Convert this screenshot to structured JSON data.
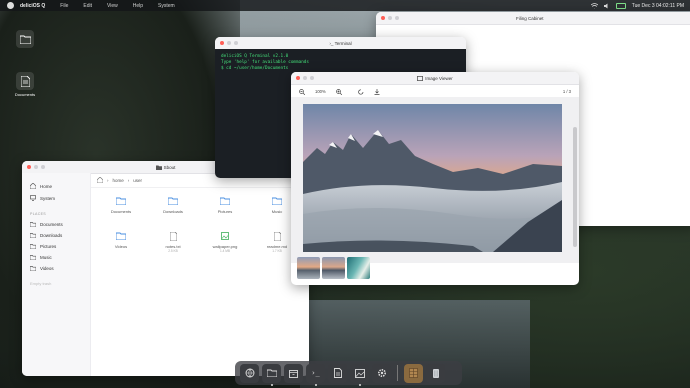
{
  "menubar": {
    "brand": "deliciOS Q",
    "menus": [
      "File",
      "Edit",
      "View",
      "Help",
      "System"
    ],
    "clock": "Tue Dec 3  04:02:11 PM"
  },
  "desktop": {
    "icons": [
      {
        "label": "",
        "icon": "folder-icon"
      },
      {
        "label": "Documents",
        "icon": "document-icon"
      }
    ]
  },
  "file_manager": {
    "title": "Sbout",
    "sidebar": {
      "top_items": [
        {
          "label": "Home",
          "icon": "home-icon"
        },
        {
          "label": "System",
          "icon": "desktop-icon"
        }
      ],
      "places_header": "PLACES",
      "places": [
        {
          "label": "Documents",
          "icon": "folder-icon"
        },
        {
          "label": "Downloads",
          "icon": "folder-icon"
        },
        {
          "label": "Pictures",
          "icon": "folder-icon"
        },
        {
          "label": "Music",
          "icon": "folder-icon"
        },
        {
          "label": "Videos",
          "icon": "folder-icon"
        }
      ],
      "empty_note": "Empty trash"
    },
    "breadcrumb": [
      "home",
      "user"
    ],
    "files": [
      {
        "name": "Documents",
        "size": "",
        "type": "folder"
      },
      {
        "name": "Downloads",
        "size": "",
        "type": "folder"
      },
      {
        "name": "Pictures",
        "size": "",
        "type": "folder"
      },
      {
        "name": "Music",
        "size": "",
        "type": "folder"
      },
      {
        "name": "Videos",
        "size": "",
        "type": "folder"
      },
      {
        "name": "notes.txt",
        "size": "2.5 KB",
        "type": "text"
      },
      {
        "name": "wallpaper.png",
        "size": "1.4 MB",
        "type": "image"
      },
      {
        "name": "readme.md",
        "size": "1.7 KB",
        "type": "text"
      }
    ]
  },
  "terminal": {
    "title": "Terminal",
    "lines": [
      {
        "text": "deliciOS Q Terminal v2.1.0",
        "color": "green"
      },
      {
        "text": "Type 'help' for available commands",
        "color": "green"
      },
      {
        "text": "$ cd ~/user/home/Documents",
        "color": "green"
      }
    ]
  },
  "filing_cabinet": {
    "title": "Filing Cabinet"
  },
  "image_viewer": {
    "title": "Image Viewer",
    "zoom": "100%",
    "page": "1 / 3",
    "thumb_count": 3
  },
  "dock": {
    "items": [
      {
        "icon": "browser-icon",
        "running": true
      },
      {
        "icon": "folder-icon",
        "running": true
      },
      {
        "icon": "archive-icon",
        "running": false
      },
      {
        "icon": "terminal-icon",
        "running": true
      },
      {
        "icon": "text-editor-icon",
        "running": false
      },
      {
        "icon": "image-viewer-icon",
        "running": true
      },
      {
        "icon": "settings-icon",
        "running": false
      },
      {
        "icon": "filing-cabinet-icon",
        "running": false
      },
      {
        "icon": "trash-icon",
        "running": false
      }
    ]
  },
  "colors": {
    "accent": "#4a8fe0",
    "terminal_bg": "#1b1f24",
    "terminal_green": "#44e07a",
    "close_red": "#ff5f57"
  }
}
